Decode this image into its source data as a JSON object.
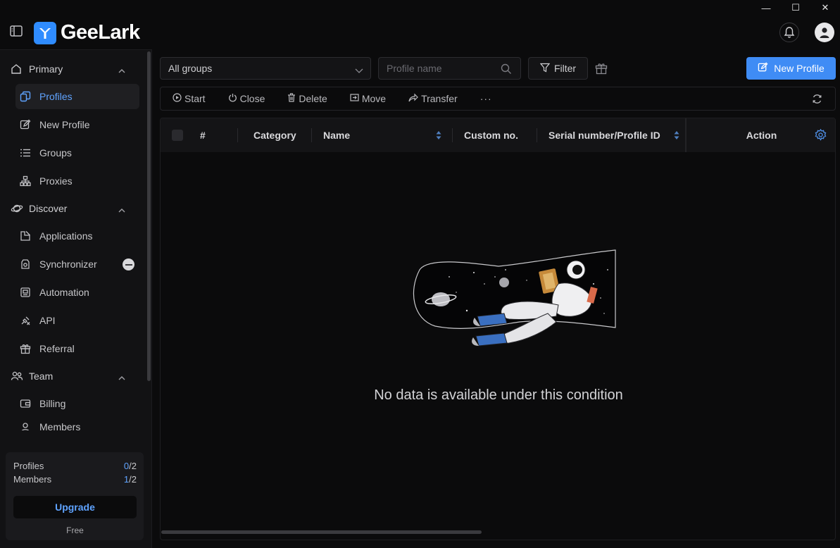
{
  "app": {
    "name": "GeeLark",
    "brand_color": "#3f8cf5"
  },
  "window": {
    "minimize": "—",
    "maximize": "☐",
    "close": "✕"
  },
  "sidebar": {
    "sections": [
      {
        "label": "Primary",
        "items": [
          "Profiles",
          "New Profile",
          "Groups",
          "Proxies"
        ]
      },
      {
        "label": "Discover",
        "items": [
          "Applications",
          "Synchronizer",
          "Automation",
          "API",
          "Referral"
        ]
      },
      {
        "label": "Team",
        "items": [
          "Billing",
          "Members"
        ]
      }
    ],
    "active_item": "Profiles",
    "plan": {
      "profiles_label": "Profiles",
      "profiles_used": "0",
      "profiles_total": "/2",
      "members_label": "Members",
      "members_used": "1",
      "members_total": "/2",
      "upgrade_label": "Upgrade",
      "tier": "Free"
    }
  },
  "toolbar": {
    "group_select": "All groups",
    "search_placeholder": "Profile name",
    "filter_label": "Filter",
    "new_profile_label": "New Profile"
  },
  "actions": {
    "start": "Start",
    "close": "Close",
    "delete": "Delete",
    "move": "Move",
    "transfer": "Transfer",
    "more": "···"
  },
  "table": {
    "columns": [
      "#",
      "Category",
      "Name",
      "Custom no.",
      "Serial number/Profile ID",
      "Action"
    ],
    "empty_message": "No data is available under this condition"
  }
}
